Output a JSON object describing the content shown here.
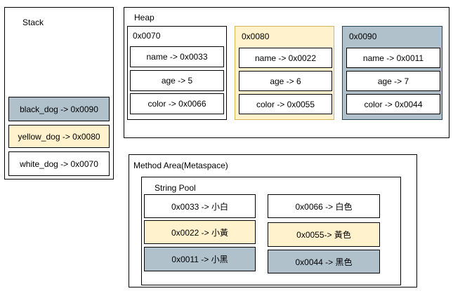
{
  "colors": {
    "white": "#ffffff",
    "yellow": "#fff2cc",
    "blue": "#b0c1cc"
  },
  "stack": {
    "title": "Stack",
    "items": [
      {
        "text": "black_dog -> 0x0090",
        "color": "blue"
      },
      {
        "text": "yellow_dog -> 0x0080",
        "color": "yellow"
      },
      {
        "text": "white_dog -> 0x0070",
        "color": "white"
      }
    ]
  },
  "heap": {
    "title": "Heap",
    "objects": [
      {
        "address": "0x0070",
        "color": "white",
        "fields": [
          "name -> 0x0033",
          "age -> 5",
          "color -> 0x0066"
        ]
      },
      {
        "address": "0x0080",
        "color": "yellow",
        "fields": [
          "name -> 0x0022",
          "age -> 6",
          "color -> 0x0055"
        ]
      },
      {
        "address": "0x0090",
        "color": "blue",
        "fields": [
          "name -> 0x0011",
          "age -> 7",
          "color -> 0x0044"
        ]
      }
    ]
  },
  "method_area": {
    "title": "Method Area(Metaspace)",
    "string_pool": {
      "title": "String Pool",
      "left": [
        {
          "text": "0x0033 -> 小白",
          "color": "white"
        },
        {
          "text": "0x0022 -> 小黃",
          "color": "yellow"
        },
        {
          "text": "0x0011 -> 小黑",
          "color": "blue"
        }
      ],
      "right": [
        {
          "text": "0x0066 -> 白色",
          "color": "white"
        },
        {
          "text": "0x0055-> 黃色",
          "color": "yellow"
        },
        {
          "text": "0x0044 -> 黑色",
          "color": "blue"
        }
      ]
    }
  }
}
